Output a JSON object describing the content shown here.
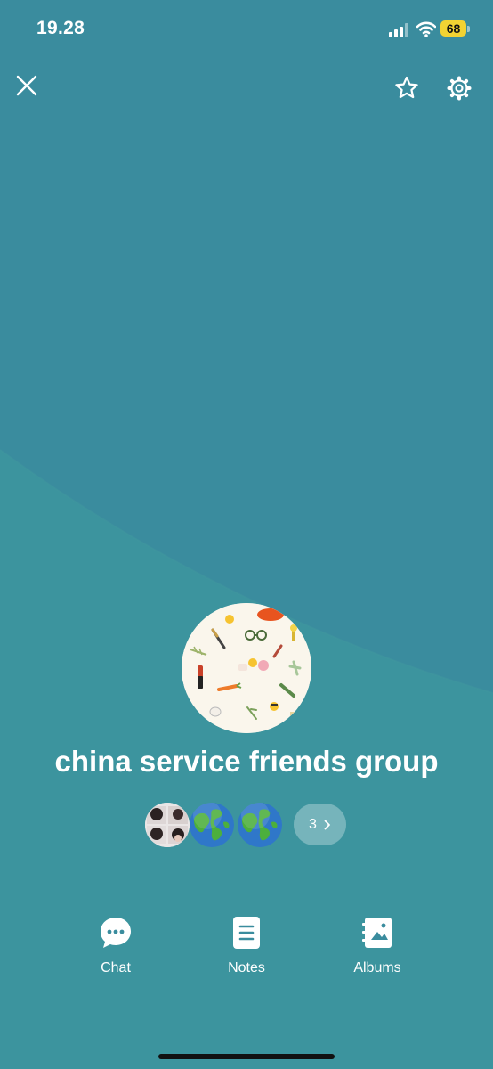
{
  "status_bar": {
    "time": "19.28",
    "battery": "68"
  },
  "toolbar": {
    "close_icon": "close-icon",
    "favorite_icon": "star-icon",
    "settings_icon": "gear-icon"
  },
  "group": {
    "name": "china service friends group",
    "avatar_icon": "illustrated-pattern-avatar",
    "members_more_count": "3"
  },
  "actions": [
    {
      "label": "Chat",
      "icon": "chat-bubble-icon"
    },
    {
      "label": "Notes",
      "icon": "note-icon"
    },
    {
      "label": "Albums",
      "icon": "album-icon"
    }
  ],
  "colors": {
    "background": "#3a8c9e",
    "background_lower": "#3e9a9c",
    "battery": "#f2d333"
  }
}
